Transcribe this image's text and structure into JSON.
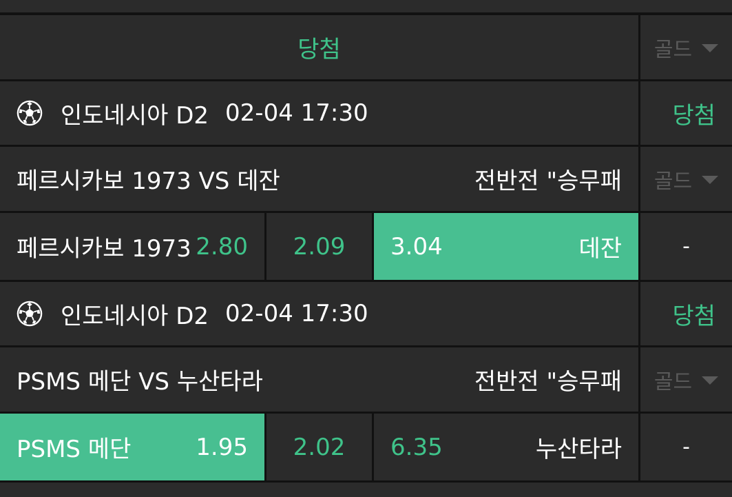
{
  "header": {
    "title": "당첨",
    "gold_label": "골드"
  },
  "matches": [
    {
      "league": "인도네시아 D2",
      "time": "02-04 17:30",
      "status": "당첨",
      "teams": "페르시카보 1973 VS 데잔",
      "market": "전반전 \"승무패",
      "gold_label": "골드",
      "home_name": "페르시카보 1973",
      "home_odd": "2.80",
      "draw_odd": "2.09",
      "away_odd": "3.04",
      "away_name": "데잔",
      "result": "-"
    },
    {
      "league": "인도네시아 D2",
      "time": "02-04 17:30",
      "status": "당첨",
      "teams": "PSMS 메단 VS 누산타라",
      "market": "전반전 \"승무패",
      "gold_label": "골드",
      "home_name": "PSMS 메단",
      "home_odd": "1.95",
      "draw_odd": "2.02",
      "away_odd": "6.35",
      "away_name": "누산타라",
      "result": "-"
    }
  ],
  "colors": {
    "accent": "#3fc38a",
    "selected": "#48bf91",
    "panel": "#2b2b2b",
    "muted": "#5a5a5a"
  },
  "icons": {
    "sport": "soccer-ball-icon",
    "dropdown": "triangle-down-icon"
  }
}
